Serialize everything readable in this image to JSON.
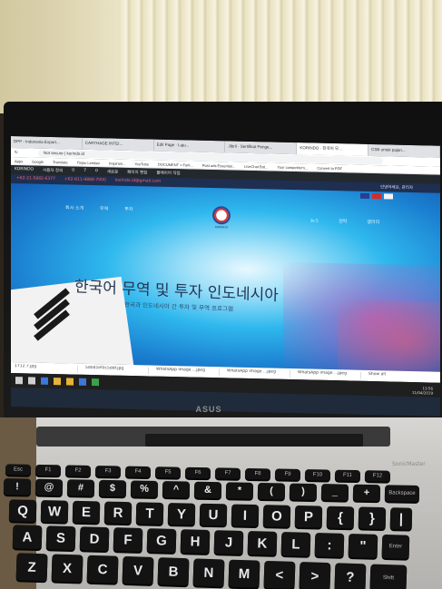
{
  "photo": {
    "subject": "laptop-screen-photo",
    "laptop_brand": "ASUS",
    "keyboard_brand_label": "SonicMaster"
  },
  "browser": {
    "tabs": [
      "DPP - Indonesia Export...",
      "CARTHAGE INTEI...",
      "Edit Page · Laju...",
      "Jibril · Sertifikat Penge...",
      "KORINDO · 한국어 무...",
      "CSB untuk pajan..."
    ],
    "address_prefix": "Not secure",
    "url": "korindo.id",
    "bookmarks": [
      "Apps",
      "Google",
      "Translate",
      "Tinjau Lembar",
      "Inspirasi...",
      "YouTube",
      "DOCUMENT + Fork...",
      "Post ads Essential...",
      "LiveChat Bot...",
      "Your competitor's...",
      "Convert to PDF"
    ],
    "wp_bar_items": [
      "KORINDO",
      "사용자 정의",
      "0",
      "7",
      "0",
      "새로운",
      "페이지 편집",
      "플레이어 작업"
    ]
  },
  "site": {
    "contact_phone_1": "+62-21-5882-6377",
    "contact_phone_2": "+62-811-9888-7000",
    "contact_email": "korindo.id@gmail.com",
    "greeting": "안녕하세요, 관리자",
    "nav_left": [
      "회사 소개",
      "무역",
      "투자"
    ],
    "nav_right": [
      "뉴스",
      "연락",
      "갤러리"
    ],
    "logo_text": "KORINDO",
    "hero_title": "한국어 무역 및 투자 인도네시아",
    "hero_subtitle": "한국과 인도네시아 간 투자 및 무역 프로그램"
  },
  "downloads": [
    "1712.7.jpg",
    "5d0d1ef0c5ddf.jpg",
    "WhatsApp Image ...jpeg",
    "WhatsApp Image ...jpeg",
    "WhatsApp Image ...jpeg"
  ],
  "taskbar": {
    "show_all": "Show all",
    "time": "13:56",
    "date": "11/04/2019"
  },
  "keyboard": {
    "row_numbers": [
      "!",
      "@",
      "#",
      "$",
      "%",
      "^",
      "&",
      "*",
      "(",
      ")",
      "_",
      "+",
      "Backspace"
    ],
    "row_top": [
      "Q",
      "W",
      "E",
      "R",
      "T",
      "Y",
      "U",
      "I",
      "O",
      "P",
      "{",
      "}",
      "|"
    ],
    "row_home": [
      "A",
      "S",
      "D",
      "F",
      "G",
      "H",
      "J",
      "K",
      "L",
      ":",
      "\"",
      "Enter"
    ],
    "row_bottom": [
      "Z",
      "X",
      "C",
      "V",
      "B",
      "N",
      "M",
      "<",
      ">",
      "?",
      "Shift"
    ]
  }
}
